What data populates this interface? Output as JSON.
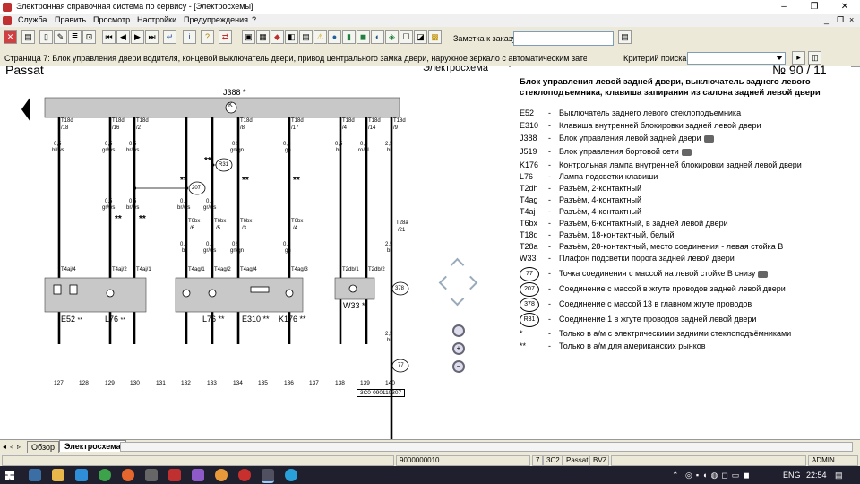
{
  "window": {
    "title": "Электронная справочная система по сервису - [Электросхемы]",
    "controls": {
      "minimize": "–",
      "restore": "❐",
      "close": "✕"
    }
  },
  "menu": {
    "items": [
      "Служба",
      "Править",
      "Просмотр",
      "Настройки",
      "Предупреждения",
      "?"
    ],
    "mdi_controls": {
      "minimize": "_",
      "restore": "❐",
      "close": "×"
    }
  },
  "toolbar": {
    "order_label": "Заметка к заказу:",
    "order_value": ""
  },
  "strip": {
    "page_title": "Страница 7: Блок управления двери водителя, концевой выключатель двери, привод центрального замка двери, наружное зеркало с автоматическим затемнением со",
    "criteria_label": "Критерий поиска:",
    "criteria_value": ""
  },
  "diagram": {
    "header_left": "Passat",
    "header_center": "Электросхема",
    "header_right": "№ 90 / 11",
    "bus_label": "J388 *",
    "bus_marker": "K",
    "ground_labels": [
      "R31",
      "207",
      "378",
      "77"
    ],
    "columns": [
      "127",
      "128",
      "129",
      "130",
      "131",
      "132",
      "133",
      "134",
      "135",
      "136",
      "137",
      "138",
      "139",
      "140"
    ],
    "drawing_number": "3C0-090110307",
    "components": [
      "E52",
      "L76",
      "L76",
      "E310",
      "K176",
      "W33"
    ],
    "marks": {
      "star": "*",
      "double_star": "**",
      "double_star_small": "**"
    },
    "terminals": [
      {
        "conn": "T18d",
        "pin": "/18",
        "size": "0,5",
        "color": "bl/ws",
        "bottom": "T4aj/4"
      },
      {
        "conn": "T18d",
        "pin": "/16",
        "size": "0,5",
        "color": "gr/ws",
        "size2": "0,5",
        "color2": "gr/ws",
        "bottom": "T4aj/2"
      },
      {
        "conn": "T18d",
        "pin": "/2",
        "size": "0,5",
        "color": "br/ws",
        "size2": "0,5",
        "color2": "br/ws",
        "bottom": "T4aj/1"
      },
      {
        "conn": "T6bx",
        "pin": "/6",
        "size": "0,5",
        "color": "br/ws",
        "size2": "0,5",
        "color2": "br",
        "bottom": "T4ag/1"
      },
      {
        "conn": "T6bx",
        "pin": "/5",
        "size": "0,5",
        "color": "gr/ws",
        "size2": "0,5",
        "color2": "gr/ws",
        "bottom": "T4ag/2"
      },
      {
        "conn": "T18d",
        "pin": "/8",
        "size": "0,5",
        "color": "gn/gn",
        "conn2": "T6bx",
        "pin2": "/3",
        "size2": "0,5",
        "color2": "gn/gn",
        "bottom": "T4ag/4"
      },
      {
        "conn": "T18d",
        "pin": "/17",
        "size": "0,5",
        "color": "gn",
        "conn2": "T6bx",
        "pin2": "/4",
        "size2": "0,5",
        "color2": "gn",
        "bottom": "T4ag/3"
      },
      {
        "conn": "T18d",
        "pin": "/4",
        "size": "0,5",
        "color": "br",
        "bottom": "T2db/1"
      },
      {
        "conn": "T18d",
        "pin": "/14",
        "size": "0,5",
        "color": "ro/bl",
        "bottom": "T2db/2"
      },
      {
        "conn": "T18d",
        "pin": "/9",
        "size": "2,5",
        "color": "br",
        "conn2": "T28a",
        "pin2": "/21",
        "size2": "2,5",
        "color2": "br",
        "size3": "2,5",
        "color3": "br"
      }
    ]
  },
  "legend": {
    "heading": "Блок управления левой задней двери, выключатель заднего левого стеклоподъемника, клавиша запирания из салона задней левой двери",
    "items": [
      {
        "code": "E52",
        "desc": "Выключатель заднего левого стеклоподъемника",
        "cam": false
      },
      {
        "code": "E310",
        "desc": "Клавиша внутренней блокировки задней левой двери",
        "cam": false
      },
      {
        "code": "J388",
        "desc": "Блок управления левой задней двери",
        "cam": true
      },
      {
        "code": "J519",
        "desc": "Блок управления бортовой сети",
        "cam": true
      },
      {
        "code": "K176",
        "desc": "Контрольная лампа внутренней блокировки задней левой двери",
        "cam": false
      },
      {
        "code": "L76",
        "desc": "Лампа подсветки клавиши",
        "cam": false
      },
      {
        "code": "T2dh",
        "desc": "Разъём, 2-контактный",
        "cam": false
      },
      {
        "code": "T4ag",
        "desc": "Разъём, 4-контактный",
        "cam": false
      },
      {
        "code": "T4aj",
        "desc": "Разъём, 4-контактный",
        "cam": false
      },
      {
        "code": "T6bx",
        "desc": "Разъём, 6-контактный, в задней левой двери",
        "cam": false
      },
      {
        "code": "T18d",
        "desc": "Разъём, 18-контактный, белый",
        "cam": false
      },
      {
        "code": "T28a",
        "desc": "Разъём, 28-контактный, место соединения - левая стойка В",
        "cam": false
      },
      {
        "code": "W33",
        "desc": "Плафон подсветки порога задней левой двери",
        "cam": false
      },
      {
        "code": "77",
        "desc": "Точка соединения с массой на левой стойке В снизу",
        "cam": true,
        "circle": true
      },
      {
        "code": "207",
        "desc": "Соединение с массой в жгуте проводов задней левой двери",
        "cam": false,
        "circle": true
      },
      {
        "code": "378",
        "desc": "Соединение с массой 13 в главном жгуте проводов",
        "cam": false,
        "circle": true
      },
      {
        "code": "R31",
        "desc": "Соединение 1 в жгуте проводов задней левой двери",
        "cam": false,
        "circle": true
      },
      {
        "code": "*",
        "desc": "Только в а/м с электрическими задними стеклоподъёмниками",
        "cam": false
      },
      {
        "code": "**",
        "desc": "Только в а/м для американских рынков",
        "cam": false
      }
    ]
  },
  "tabs": [
    "Обзор",
    "Электросхема"
  ],
  "status": {
    "code": "9000000010",
    "page": "7",
    "model_code": "3C2",
    "model": "Passat",
    "engine": "BVZ",
    "user": "ADMIN"
  },
  "taskbar": {
    "lang": "ENG",
    "time": "22:54"
  },
  "colors": {
    "wire": "#000000",
    "component_fill": "#c8c8c8",
    "bus_fill": "#c8c8c8",
    "toolbar": "#ece9d8",
    "taskbar": "#1f1f2e"
  }
}
